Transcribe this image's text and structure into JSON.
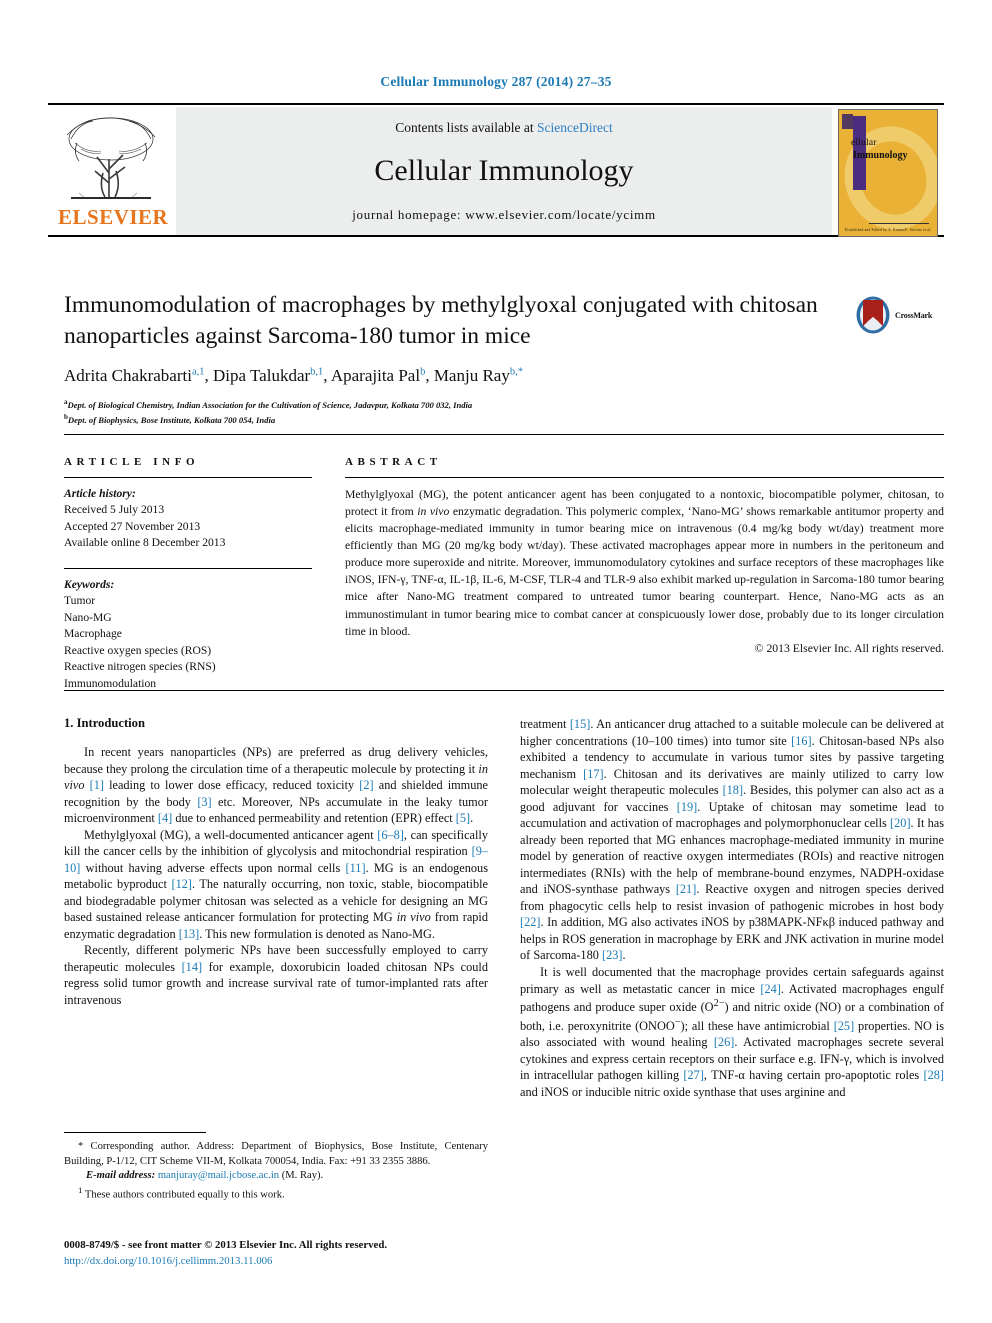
{
  "running_head": "Cellular Immunology 287 (2014) 27–35",
  "masthead": {
    "publisher_name": "ELSEVIER",
    "contents_prefix": "Contents lists available at ",
    "contents_link": "ScienceDirect",
    "journal_name": "Cellular Immunology",
    "homepage_line": "journal homepage: www.elsevier.com/locate/ycimm",
    "cover": {
      "title_line1": "ellular",
      "title_line2": "Immunology",
      "footer": "Established and Edited by\nA. Kumar/E. Sercarz et al."
    }
  },
  "article": {
    "title": "Immunomodulation of macrophages by methylglyoxal conjugated with chitosan nanoparticles against Sarcoma-180 tumor in mice",
    "authors": [
      {
        "name": "Adrita Chakrabarti",
        "marks": "a,1",
        "sep": ", "
      },
      {
        "name": "Dipa Talukdar",
        "marks": "b,1",
        "sep": ", "
      },
      {
        "name": "Aparajita Pal",
        "marks": "b",
        "sep": ", "
      },
      {
        "name": "Manju Ray",
        "marks": "b,*",
        "sep": ""
      }
    ],
    "affiliations": [
      {
        "mark": "a",
        "text": "Dept. of Biological Chemistry, Indian Association for the Cultivation of Science, Jadavpur, Kolkata 700 032, India"
      },
      {
        "mark": "b",
        "text": "Dept. of Biophysics, Bose Institute, Kolkata 700 054, India"
      }
    ],
    "crossmark_label": "CrossMark"
  },
  "article_info": {
    "heading": "ARTICLE INFO",
    "history_label": "Article history:",
    "history": [
      "Received 5 July 2013",
      "Accepted 27 November 2013",
      "Available online 8 December 2013"
    ],
    "keywords_label": "Keywords:",
    "keywords": [
      "Tumor",
      "Nano-MG",
      "Macrophage",
      "Reactive oxygen species (ROS)",
      "Reactive nitrogen species (RNS)",
      "Immunomodulation"
    ]
  },
  "abstract": {
    "heading": "ABSTRACT",
    "text": "Methylglyoxal (MG), the potent anticancer agent has been conjugated to a nontoxic, biocompatible polymer, chitosan, to protect it from in vivo enzymatic degradation. This polymeric complex, ‘Nano-MG’ shows remarkable antitumor property and elicits macrophage-mediated immunity in tumor bearing mice on intravenous (0.4 mg/kg body wt/day) treatment more efficiently than MG (20 mg/kg body wt/day). These activated macrophages appear more in numbers in the peritoneum and produce more superoxide and nitrite. Moreover, immunomodulatory cytokines and surface receptors of these macrophages like iNOS, IFN-γ, TNF-α, IL-1β, IL-6, M-CSF, TLR-4 and TLR-9 also exhibit marked up-regulation in Sarcoma-180 tumor bearing mice after Nano-MG treatment compared to untreated tumor bearing counterpart. Hence, Nano-MG acts as an immunostimulant in tumor bearing mice to combat cancer at conspicuously lower dose, probably due to its longer circulation time in blood.",
    "copyright": "© 2013 Elsevier Inc. All rights reserved."
  },
  "introduction": {
    "heading": "1. Introduction",
    "left_paragraphs": [
      "In recent years nanoparticles (NPs) are preferred as drug delivery vehicles, because they prolong the circulation time of a therapeutic molecule by protecting it in vivo [1] leading to lower dose efficacy, reduced toxicity [2] and shielded immune recognition by the body [3] etc. Moreover, NPs accumulate in the leaky tumor microenvironment [4] due to enhanced permeability and retention (EPR) effect [5].",
      "Methylglyoxal (MG), a well-documented anticancer agent [6–8], can specifically kill the cancer cells by the inhibition of glycolysis and mitochondrial respiration [9–10] without having adverse effects upon normal cells [11]. MG is an endogenous metabolic byproduct [12]. The naturally occurring, non toxic, stable, biocompatible and biodegradable polymer chitosan was selected as a vehicle for designing an MG based sustained release anticancer formulation for protecting MG in vivo from rapid enzymatic degradation [13]. This new formulation is denoted as Nano-MG.",
      "Recently, different polymeric NPs have been successfully employed to carry therapeutic molecules [14] for example, doxorubicin loaded chitosan NPs could regress solid tumor growth and increase survival rate of tumor-implanted rats after intravenous"
    ],
    "right_paragraphs": [
      "treatment [15]. An anticancer drug attached to a suitable molecule can be delivered at higher concentrations (10–100 times) into tumor site [16]. Chitosan-based NPs also exhibited a tendency to accumulate in various tumor sites by passive targeting mechanism [17]. Chitosan and its derivatives are mainly utilized to carry low molecular weight therapeutic molecules [18]. Besides, this polymer can also act as a good adjuvant for vaccines [19]. Uptake of chitosan may sometime lead to accumulation and activation of macrophages and polymorphonuclear cells [20]. It has already been reported that MG enhances macrophage-mediated immunity in murine model by generation of reactive oxygen intermediates (ROIs) and reactive nitrogen intermediates (RNIs) with the help of membrane-bound enzymes, NADPH-oxidase and iNOS-synthase pathways [21]. Reactive oxygen and nitrogen species derived from phagocytic cells help to resist invasion of pathogenic microbes in host body [22]. In addition, MG also activates iNOS by p38MAPK-NFκβ induced pathway and helps in ROS generation in macrophage by ERK and JNK activation in murine model of Sarcoma-180 [23].",
      "It is well documented that the macrophage provides certain safeguards against primary as well as metastatic cancer in mice [24]. Activated macrophages engulf pathogens and produce super oxide (O2−) and nitric oxide (NO) or a combination of both, i.e. peroxynitrite (ONOO−); all these have antimicrobial [25] properties. NO is also associated with wound healing [26]. Activated macrophages secrete several cytokines and express certain receptors on their surface e.g. IFN-γ, which is involved in intracellular pathogen killing [27], TNF-α having certain pro-apoptotic roles [28] and iNOS or inducible nitric oxide synthase that uses arginine and"
    ]
  },
  "footnotes": {
    "corresponding": "* Corresponding author. Address: Department of Biophysics, Bose Institute, Centenary Building, P-1/12, CIT Scheme VII-M, Kolkata 700054, India. Fax: +91 33 2355 3886.",
    "email_label": "E-mail address:",
    "email": "manjuray@mail.jcbose.ac.in",
    "email_suffix": "(M. Ray).",
    "equal_contrib_mark": "1",
    "equal_contrib": "These authors contributed equally to this work."
  },
  "imprint": {
    "line1": "0008-8749/$ - see front matter © 2013 Elsevier Inc. All rights reserved.",
    "doi": "http://dx.doi.org/10.1016/j.cellimm.2013.11.006"
  },
  "colors": {
    "link": "#1b7ab5",
    "elsevier_orange": "#e8741c",
    "band_gray": "#eceded",
    "cover_gold": "#e9b135",
    "cover_purple": "#4b2d7f",
    "crossmark_red": "#a8201a"
  }
}
